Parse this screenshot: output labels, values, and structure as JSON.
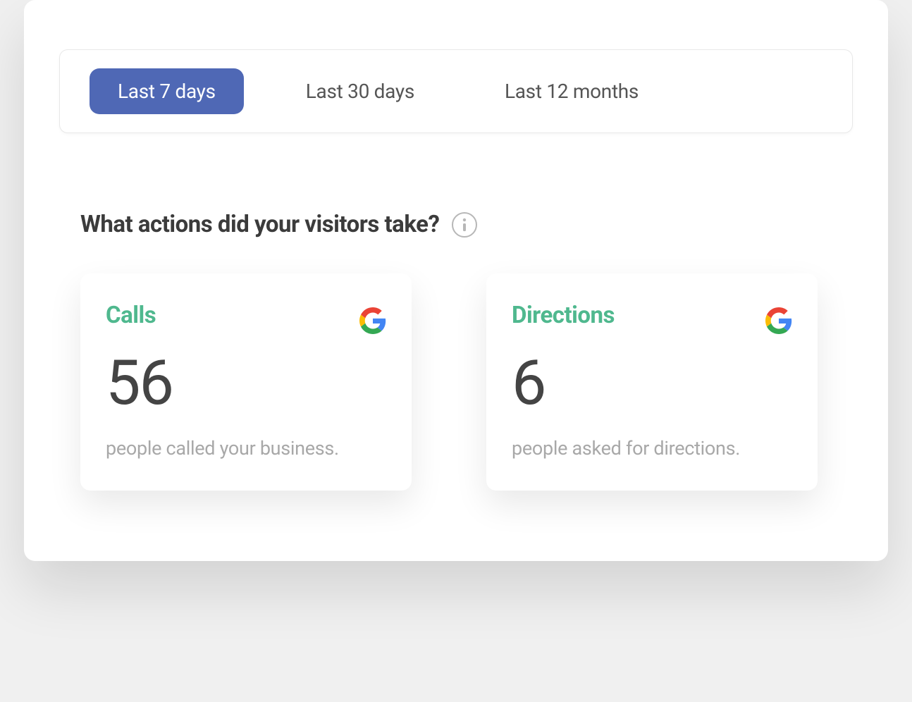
{
  "tabs": {
    "items": [
      {
        "label": "Last 7 days",
        "active": true
      },
      {
        "label": "Last 30 days",
        "active": false
      },
      {
        "label": "Last 12 months",
        "active": false
      }
    ]
  },
  "section": {
    "heading": "What actions did your visitors take?"
  },
  "cards": {
    "calls": {
      "title": "Calls",
      "value": "56",
      "description": "people called your business."
    },
    "directions": {
      "title": "Directions",
      "value": "6",
      "description": "people asked for directions."
    }
  }
}
